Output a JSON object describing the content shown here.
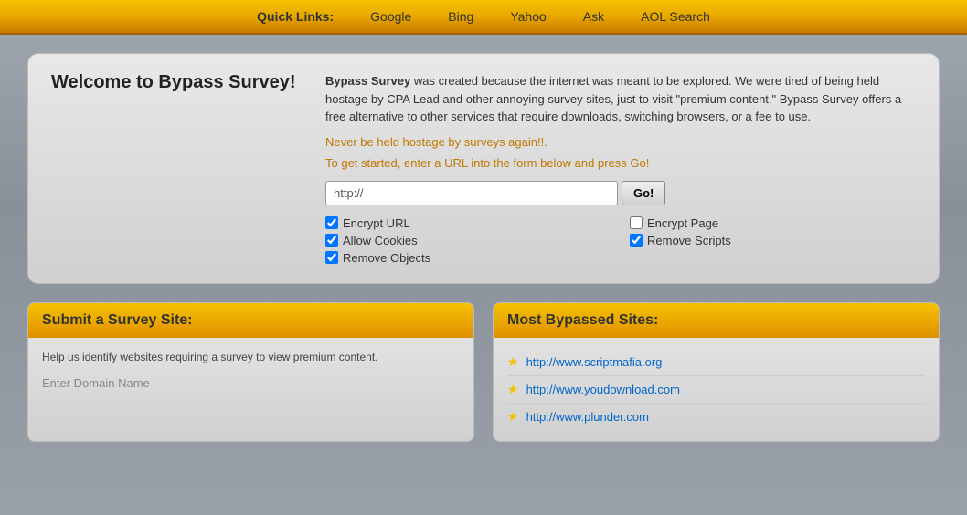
{
  "nav": {
    "label": "Quick Links:",
    "links": [
      {
        "text": "Google",
        "url": "#"
      },
      {
        "text": "Bing",
        "url": "#"
      },
      {
        "text": "Yahoo",
        "url": "#"
      },
      {
        "text": "Ask",
        "url": "#"
      },
      {
        "text": "AOL Search",
        "url": "#"
      }
    ]
  },
  "welcome": {
    "title": "Welcome to Bypass Survey!",
    "description_intro": "Bypass Survey",
    "description_body": " was created because the internet was meant to be explored. We were tired of being held hostage by CPA Lead and other annoying survey sites, just to visit \"premium content.\" Bypass Survey offers a free alternative to other services that require downloads, switching browsers, or a fee to use.",
    "tagline": "Never be held hostage by surveys again!!.",
    "instruction": "To get started, enter a URL into the form below and press Go!",
    "url_placeholder": "http://",
    "go_label": "Go!",
    "options": [
      {
        "id": "encrypt-url",
        "label": "Encrypt URL",
        "checked": true
      },
      {
        "id": "encrypt-page",
        "label": "Encrypt Page",
        "checked": false
      },
      {
        "id": "allow-cookies",
        "label": "Allow Cookies",
        "checked": true
      },
      {
        "id": "remove-scripts",
        "label": "Remove Scripts",
        "checked": true
      },
      {
        "id": "remove-objects",
        "label": "Remove Objects",
        "checked": true
      }
    ]
  },
  "submit_panel": {
    "title": "Submit a Survey Site:",
    "description": "Help us identify websites requiring a survey to view premium content.",
    "input_placeholder": "Enter Domain Name"
  },
  "bypassed_panel": {
    "title": "Most Bypassed Sites:",
    "sites": [
      {
        "url": "http://www.scriptmafia.org",
        "display": "http://www.scriptmafia.org"
      },
      {
        "url": "http://www.youdownload.com",
        "display": "http://www.youdownload.com"
      },
      {
        "url": "http://www.plunder.com",
        "display": "http://www.plunder.com"
      }
    ]
  }
}
